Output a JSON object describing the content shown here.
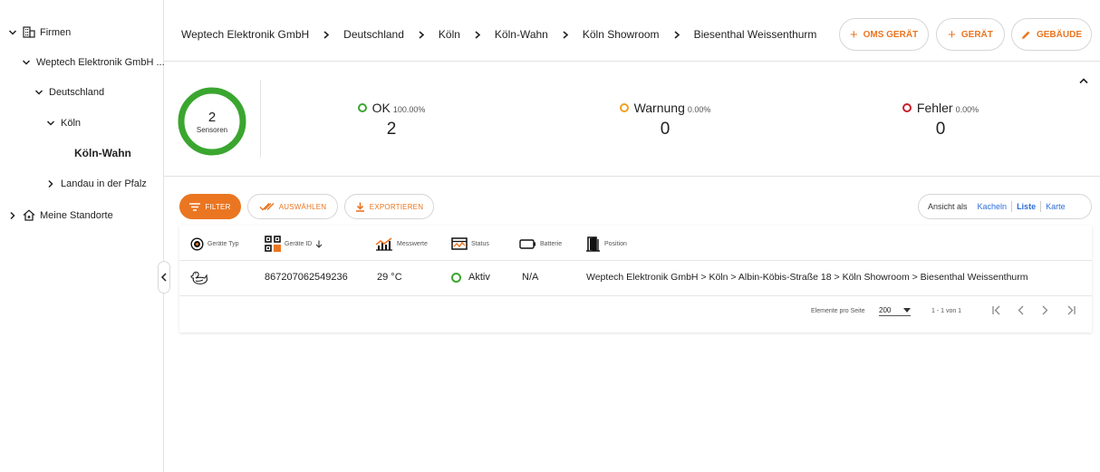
{
  "sidebar": {
    "items": [
      {
        "label": "Firmen",
        "icon": "building-icon",
        "expanded": true
      },
      {
        "label": "Weptech Elektronik GmbH ...",
        "expanded": true
      },
      {
        "label": "Deutschland",
        "expanded": true
      },
      {
        "label": "Köln",
        "expanded": true
      },
      {
        "label": "Köln-Wahn",
        "active": true
      },
      {
        "label": "Landau in der Pfalz",
        "expanded": false
      },
      {
        "label": "Meine Standorte",
        "icon": "home-icon",
        "expanded": false
      }
    ]
  },
  "header": {
    "breadcrumb": [
      "Weptech Elektronik GmbH",
      "Deutschland",
      "Köln",
      "Köln-Wahn",
      "Köln Showroom",
      "Biesenthal Weissenthurm"
    ],
    "buttons": {
      "oms_device": "OMS GERÄT",
      "device": "GERÄT",
      "building": "GEBÄUDE"
    }
  },
  "stats": {
    "sensors_count": "2",
    "sensors_label": "Sensoren",
    "ok": {
      "label": "OK",
      "percent": "100.00%",
      "value": "2",
      "color": "#3aa62f"
    },
    "warning": {
      "label": "Warnung",
      "percent": "0.00%",
      "value": "0",
      "color": "#f0a020"
    },
    "error": {
      "label": "Fehler",
      "percent": "0.00%",
      "value": "0",
      "color": "#c8202a"
    }
  },
  "toolbar": {
    "filter": "FILTER",
    "select": "AUSWÄHLEN",
    "export": "EXPORTIEREN"
  },
  "view": {
    "label": "Ansicht als",
    "options": [
      "Kacheln",
      "Liste",
      "Karte"
    ],
    "selected": "Liste"
  },
  "table": {
    "columns": {
      "type": "Geräte Typ",
      "id": "Geräte ID",
      "values": "Messwerte",
      "status": "Status",
      "battery": "Batterie",
      "position": "Position"
    },
    "rows": [
      {
        "type_icon": "duck-icon",
        "id": "867207062549236",
        "value": "29 °C",
        "status": "Aktiv",
        "battery": "N/A",
        "position": "Weptech Elektronik GmbH > Köln > Albin-Köbis-Straße 18 > Köln Showroom > Biesenthal Weissenthurm"
      }
    ]
  },
  "paginator": {
    "per_page_label": "Elemente pro Seite",
    "per_page": "200",
    "range": "1 - 1 von 1"
  },
  "colors": {
    "accent": "#ea7622",
    "link": "#2e6dd8",
    "ok": "#3aa62f"
  }
}
